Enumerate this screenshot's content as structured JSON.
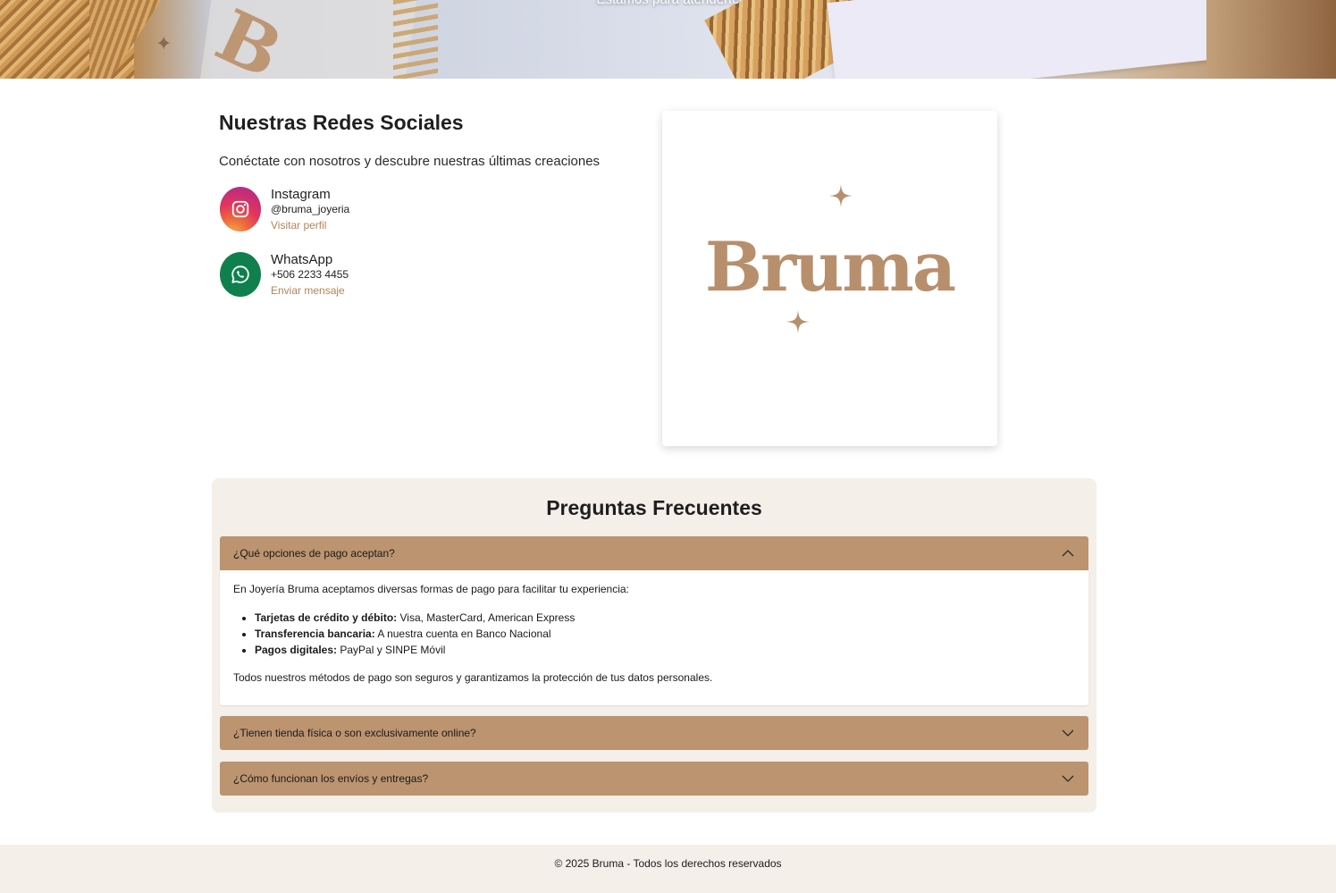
{
  "hero": {
    "tagline": "Estamos para atenderte"
  },
  "social": {
    "title": "Nuestras Redes Sociales",
    "subtitle": "Conéctate con nosotros y descubre nuestras últimas creaciones",
    "items": [
      {
        "name": "Instagram",
        "handle": "@bruma_joyeria",
        "link_label": "Visitar perfil",
        "icon": "instagram-icon"
      },
      {
        "name": "WhatsApp",
        "handle": "+506 2233 4455",
        "link_label": "Enviar mensaje",
        "icon": "whatsapp-icon"
      }
    ]
  },
  "logo": {
    "brand": "Bruma",
    "color": "#b88f6c"
  },
  "faq": {
    "title": "Preguntas Frecuentes",
    "items": [
      {
        "question": "¿Qué opciones de pago aceptan?",
        "expanded": true,
        "intro": "En Joyería Bruma aceptamos diversas formas de pago para facilitar tu experiencia:",
        "bullets": [
          {
            "label": "Tarjetas de crédito y débito:",
            "text": " Visa, MasterCard, American Express"
          },
          {
            "label": "Transferencia bancaria:",
            "text": " A nuestra cuenta en Banco Nacional"
          },
          {
            "label": "Pagos digitales:",
            "text": " PayPal y SINPE Móvil"
          }
        ],
        "outro": "Todos nuestros métodos de pago son seguros y garantizamos la protección de tus datos personales."
      },
      {
        "question": "¿Tienen tienda física o son exclusivamente online?",
        "expanded": false
      },
      {
        "question": "¿Cómo funcionan los envíos y entregas?",
        "expanded": false
      }
    ]
  },
  "footer": {
    "text": "© 2025 Bruma - Todos los derechos reservados"
  },
  "colors": {
    "accent": "#bc946f",
    "link": "#b38559",
    "panel_bg": "#f4efe9",
    "whatsapp": "#0f7f4e"
  }
}
